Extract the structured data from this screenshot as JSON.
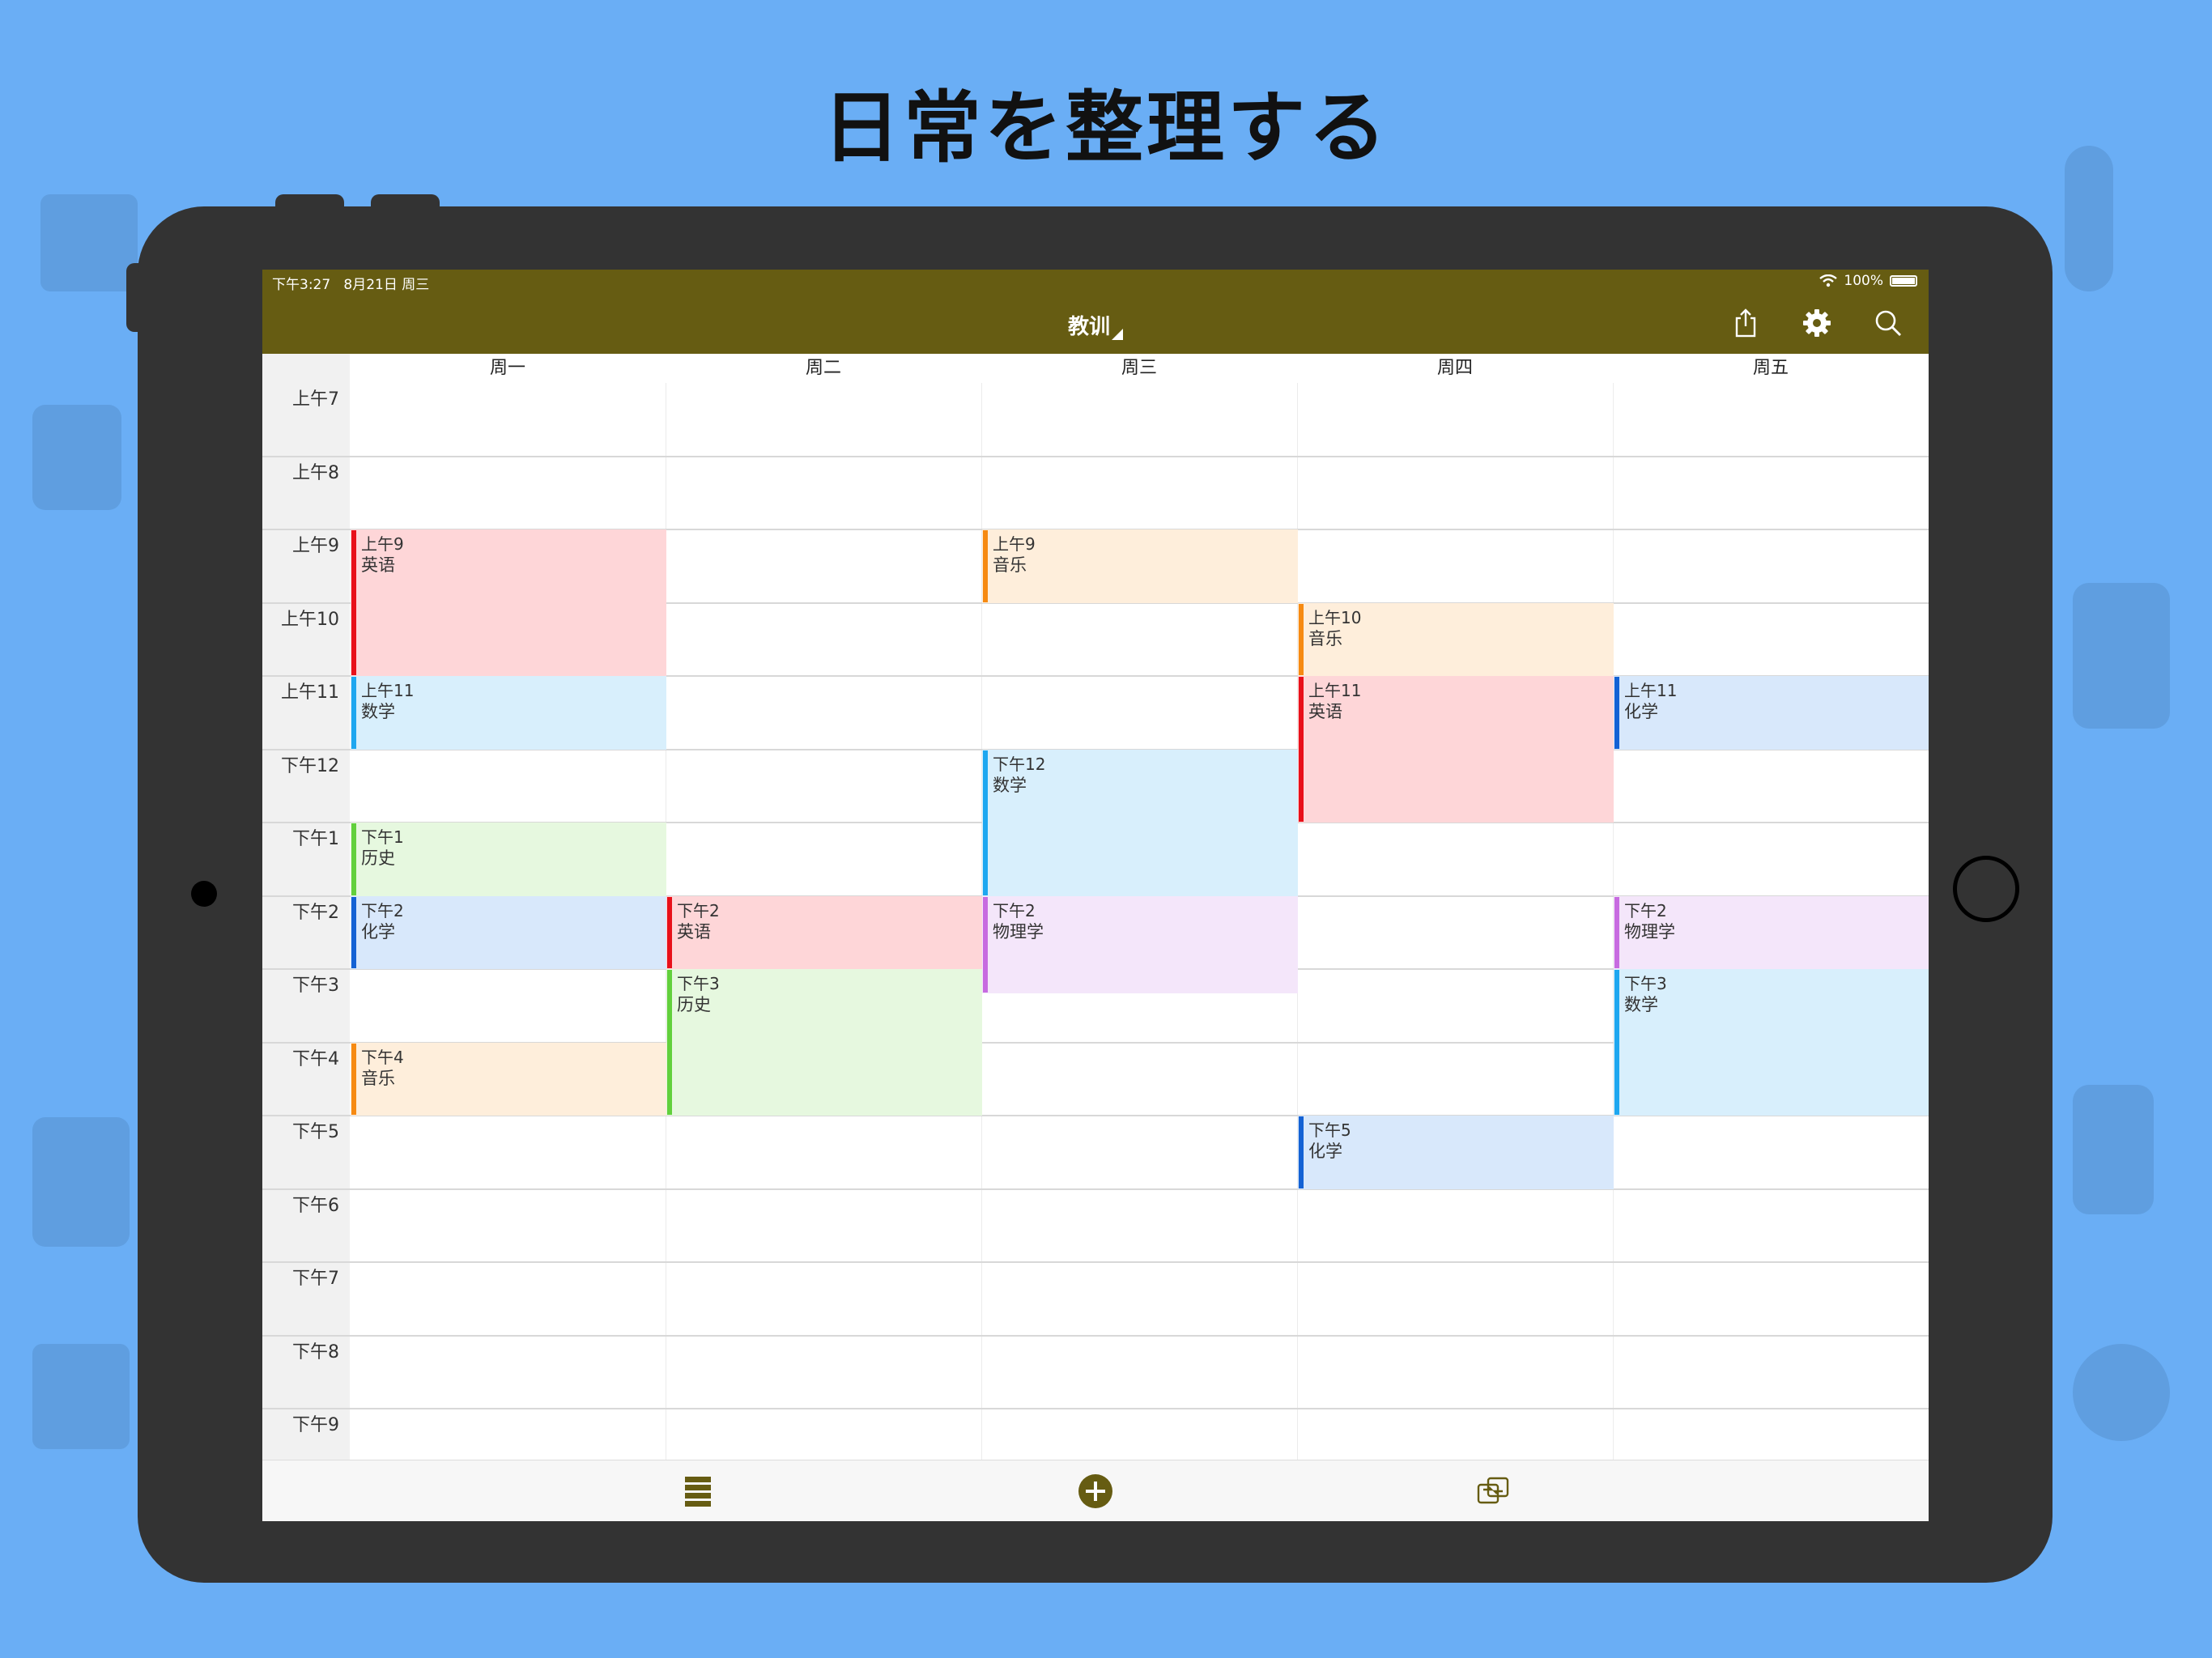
{
  "headline": "日常を整理する",
  "status": {
    "time": "下午3:27",
    "date": "8月21日 周三",
    "battery": "100%"
  },
  "nav": {
    "title": "教训",
    "icons": [
      "share-icon",
      "gear-icon",
      "search-icon"
    ]
  },
  "days": [
    "周一",
    "周二",
    "周三",
    "周四",
    "周五"
  ],
  "hours": [
    "上午7",
    "上午8",
    "上午9",
    "上午10",
    "上午11",
    "下午12",
    "下午1",
    "下午2",
    "下午3",
    "下午4",
    "下午5",
    "下午6",
    "下午7",
    "下午8",
    "下午9"
  ],
  "events": [
    {
      "day": 0,
      "start": 2,
      "duration": 2,
      "time": "上午9",
      "name": "英语",
      "color": "#e8101a",
      "fill": "#fed6d8"
    },
    {
      "day": 0,
      "start": 4,
      "duration": 1,
      "time": "上午11",
      "name": "数学",
      "color": "#1ea7f0",
      "fill": "#d8effc"
    },
    {
      "day": 0,
      "start": 6,
      "duration": 1,
      "time": "下午1",
      "name": "历史",
      "color": "#62d03c",
      "fill": "#e6f8df"
    },
    {
      "day": 0,
      "start": 7,
      "duration": 1,
      "time": "下午2",
      "name": "化学",
      "color": "#1462d4",
      "fill": "#d8e8fb"
    },
    {
      "day": 0,
      "start": 9,
      "duration": 1,
      "time": "下午4",
      "name": "音乐",
      "color": "#f68a12",
      "fill": "#feeedb"
    },
    {
      "day": 1,
      "start": 7,
      "duration": 1,
      "time": "下午2",
      "name": "英语",
      "color": "#e8101a",
      "fill": "#fed6d8"
    },
    {
      "day": 1,
      "start": 8,
      "duration": 2,
      "time": "下午3",
      "name": "历史",
      "color": "#62d03c",
      "fill": "#e6f8df"
    },
    {
      "day": 2,
      "start": 2,
      "duration": 1,
      "time": "上午9",
      "name": "音乐",
      "color": "#f68a12",
      "fill": "#feeedb"
    },
    {
      "day": 2,
      "start": 5,
      "duration": 2,
      "time": "下午12",
      "name": "数学",
      "color": "#1ea7f0",
      "fill": "#d8effc"
    },
    {
      "day": 2,
      "start": 7,
      "duration": 1.33,
      "time": "下午2",
      "name": "物理学",
      "color": "#c76be0",
      "fill": "#f4e6fa"
    },
    {
      "day": 3,
      "start": 3,
      "duration": 1,
      "time": "上午10",
      "name": "音乐",
      "color": "#f68a12",
      "fill": "#feeedb"
    },
    {
      "day": 3,
      "start": 4,
      "duration": 2,
      "time": "上午11",
      "name": "英语",
      "color": "#e8101a",
      "fill": "#fed6d8"
    },
    {
      "day": 3,
      "start": 10,
      "duration": 1,
      "time": "下午5",
      "name": "化学",
      "color": "#1462d4",
      "fill": "#d8e8fb"
    },
    {
      "day": 4,
      "start": 4,
      "duration": 1,
      "time": "上午11",
      "name": "化学",
      "color": "#1462d4",
      "fill": "#d8e8fb"
    },
    {
      "day": 4,
      "start": 7,
      "duration": 1,
      "time": "下午2",
      "name": "物理学",
      "color": "#c76be0",
      "fill": "#f4e6fa"
    },
    {
      "day": 4,
      "start": 8,
      "duration": 2,
      "time": "下午3",
      "name": "数学",
      "color": "#1ea7f0",
      "fill": "#d8effc"
    }
  ],
  "bottombar": {
    "icons": [
      "list-icon",
      "add-icon",
      "switch-icon"
    ]
  },
  "colors": {
    "navbar": "#665c12",
    "background": "#6aaef5",
    "tablet": "#333333"
  }
}
